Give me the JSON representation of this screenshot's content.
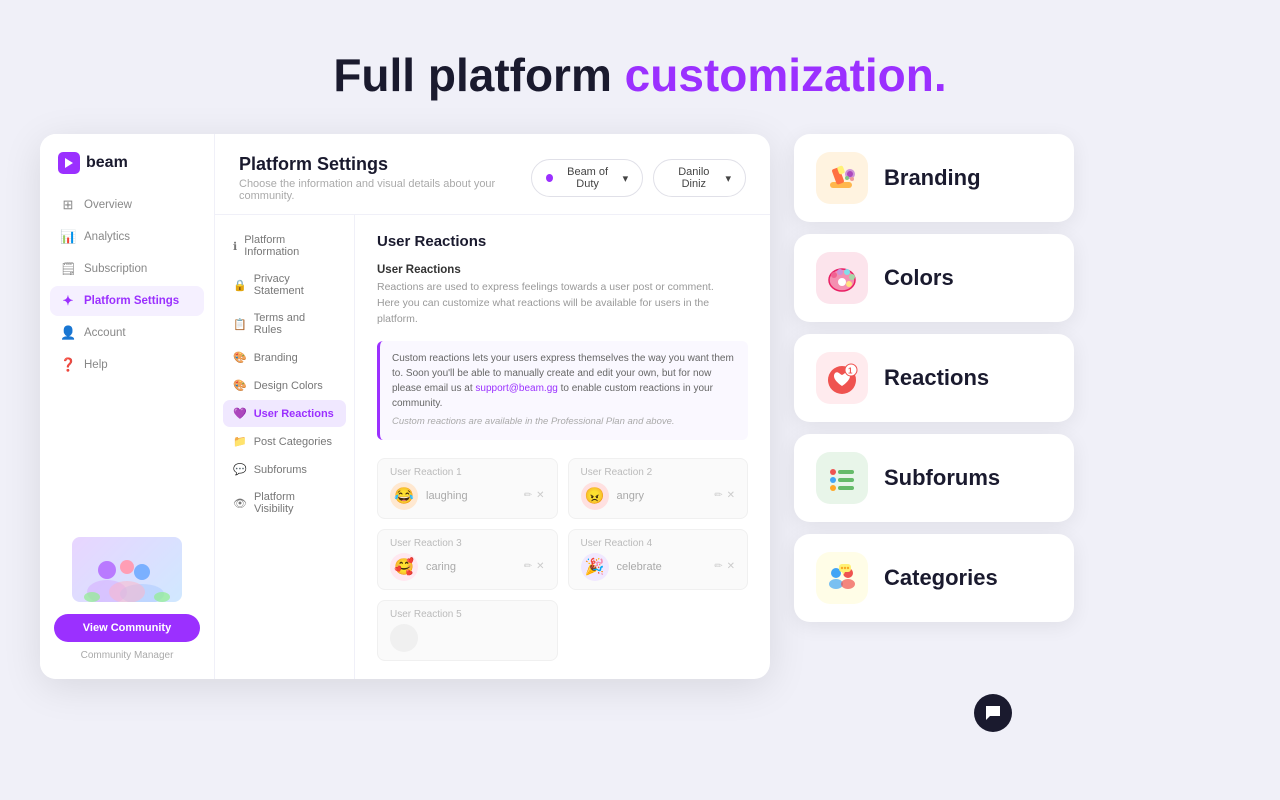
{
  "page": {
    "hero": {
      "title_plain": "Full platform ",
      "title_purple": "customization."
    }
  },
  "sidebar": {
    "logo_text": "beam",
    "nav_items": [
      {
        "id": "overview",
        "label": "Overview",
        "icon": "⊞"
      },
      {
        "id": "analytics",
        "label": "Analytics",
        "icon": "📊"
      },
      {
        "id": "subscription",
        "label": "Subscription",
        "icon": "🗒"
      },
      {
        "id": "platform-settings",
        "label": "Platform Settings",
        "icon": "✦",
        "active": true
      },
      {
        "id": "account",
        "label": "Account",
        "icon": "👤"
      },
      {
        "id": "help",
        "label": "Help",
        "icon": "❓"
      }
    ],
    "view_community_btn": "View Community",
    "community_manager_label": "Community Manager"
  },
  "platform_settings": {
    "title": "Platform Settings",
    "subtitle": "Choose the information and visual details about your community.",
    "dropdown_community": "Beam of Duty",
    "dropdown_user": "Danilo Diniz",
    "settings_nav": [
      {
        "id": "platform-info",
        "label": "Platform Information",
        "icon": "ℹ"
      },
      {
        "id": "privacy",
        "label": "Privacy Statement",
        "icon": "🔒"
      },
      {
        "id": "terms",
        "label": "Terms and Rules",
        "icon": "📋"
      },
      {
        "id": "branding",
        "label": "Branding",
        "icon": "🎨"
      },
      {
        "id": "design-colors",
        "label": "Design Colors",
        "icon": "🎨"
      },
      {
        "id": "user-reactions",
        "label": "User Reactions",
        "icon": "💜",
        "active": true
      },
      {
        "id": "post-categories",
        "label": "Post Categories",
        "icon": "📁"
      },
      {
        "id": "subforums",
        "label": "Subforums",
        "icon": "💬"
      },
      {
        "id": "platform-visibility",
        "label": "Platform Visibility",
        "icon": "👁"
      }
    ],
    "user_reactions": {
      "section_title": "User Reactions",
      "label": "User Reactions",
      "description": "Reactions are used to express feelings towards a user post or comment.\nHere you can customize what reactions will be available for users in the platform.",
      "info_box": {
        "main_text": "Custom reactions lets your users express themselves the way you want them to. Soon you'll be able to manually create and edit your own, but for now please email us at support@beam.gg to enable custom reactions in your community.",
        "note": "Custom reactions are available in the Professional Plan and above.",
        "link": "support@beam.gg"
      },
      "reactions": [
        {
          "id": 1,
          "label": "User Reaction 1",
          "name": "laughing",
          "emoji": "😂",
          "color": "#ffe8d0"
        },
        {
          "id": 2,
          "label": "User Reaction 2",
          "name": "angry",
          "emoji": "😠",
          "color": "#ffe0e0"
        },
        {
          "id": 3,
          "label": "User Reaction 3",
          "name": "caring",
          "emoji": "🥰",
          "color": "#ffe8f0"
        },
        {
          "id": 4,
          "label": "User Reaction 4",
          "name": "celebrate",
          "emoji": "🎉",
          "color": "#f0e8ff"
        },
        {
          "id": 5,
          "label": "User Reaction 5",
          "name": "",
          "emoji": "",
          "color": "#f5f5f5"
        }
      ]
    }
  },
  "feature_cards": [
    {
      "id": "branding",
      "label": "Branding",
      "emoji": "✏️",
      "bg": "#fff3e0"
    },
    {
      "id": "colors",
      "label": "Colors",
      "emoji": "🎨",
      "bg": "#fce4ec"
    },
    {
      "id": "reactions",
      "label": "Reactions",
      "emoji": "❤️",
      "bg": "#ffebee"
    },
    {
      "id": "subforums",
      "label": "Subforums",
      "emoji": "📋",
      "bg": "#e8f5e9"
    },
    {
      "id": "categories",
      "label": "Categories",
      "emoji": "👥",
      "bg": "#fffde7"
    }
  ]
}
